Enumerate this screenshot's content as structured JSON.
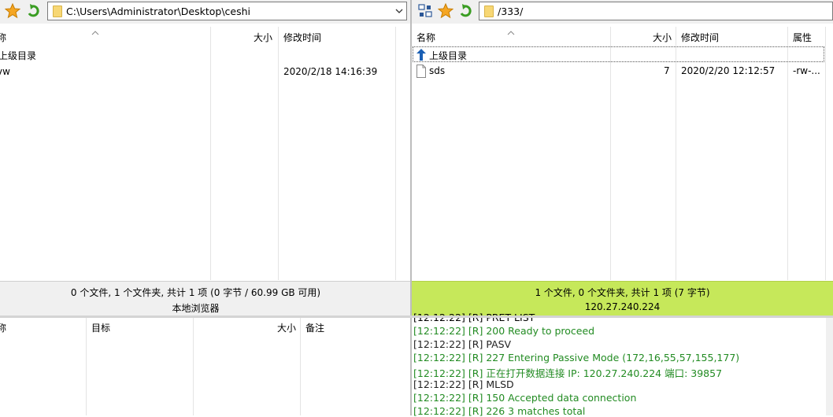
{
  "local": {
    "path": "C:\\Users\\Administrator\\Desktop\\ceshi",
    "columns": {
      "name": "称",
      "size": "大小",
      "modified": "修改时间"
    },
    "rows": [
      {
        "name": "上级目录",
        "size": "",
        "modified": ""
      },
      {
        "name": "vw",
        "size": "",
        "modified": "2020/2/18 14:16:39"
      }
    ],
    "status": "0 个文件, 1 个文件夹, 共计 1 项 (0 字节 / 60.99 GB 可用)",
    "label": "本地浏览器"
  },
  "remote": {
    "path": "/333/",
    "columns": {
      "name": "名称",
      "size": "大小",
      "modified": "修改时间",
      "attr": "属性"
    },
    "parent_label": "上级目录",
    "rows": [
      {
        "name": "sds",
        "size": "7",
        "modified": "2020/2/20 12:12:57",
        "attr": "-rw-..."
      }
    ],
    "status": "1 个文件, 0 个文件夹, 共计 1 项 (7 字节)",
    "label": "120.27.240.224",
    "status_color": "#c6e85a"
  },
  "queue": {
    "columns": {
      "name": "称",
      "target": "目标",
      "size": "大小",
      "note": "备注"
    }
  },
  "log": [
    {
      "ts": "[12:12:22]",
      "tag": "[R]",
      "msg": "PRET LIST",
      "color": "dark"
    },
    {
      "ts": "[12:12:22]",
      "tag": "[R]",
      "msg": "200 Ready to proceed",
      "color": "green"
    },
    {
      "ts": "[12:12:22]",
      "tag": "[R]",
      "msg": "PASV",
      "color": "dark"
    },
    {
      "ts": "[12:12:22]",
      "tag": "[R]",
      "msg": "227 Entering Passive Mode (172,16,55,57,155,177)",
      "color": "green"
    },
    {
      "ts": "[12:12:22]",
      "tag": "[R]",
      "msg": "正在打开数据连接 IP: 120.27.240.224 端口: 39857",
      "color": "green"
    },
    {
      "ts": "[12:12:22]",
      "tag": "[R]",
      "msg": "MLSD",
      "color": "dark"
    },
    {
      "ts": "[12:12:22]",
      "tag": "[R]",
      "msg": "150 Accepted data connection",
      "color": "green"
    },
    {
      "ts": "[12:12:22]",
      "tag": "[R]",
      "msg": "226 3 matches total",
      "color": "green"
    }
  ],
  "icons": {
    "favorite": "star-icon",
    "refresh": "refresh-icon",
    "site_manager": "site-manager-icon",
    "folder": "folder-icon",
    "file": "file-icon",
    "up": "up-arrow-icon",
    "dropdown": "chevron-down-icon",
    "sort": "sort-arrow-icon"
  },
  "colors": {
    "accent_green": "#228b22",
    "remote_status_bg": "#c6e85a",
    "local_status_bg": "#f0f0f0"
  }
}
